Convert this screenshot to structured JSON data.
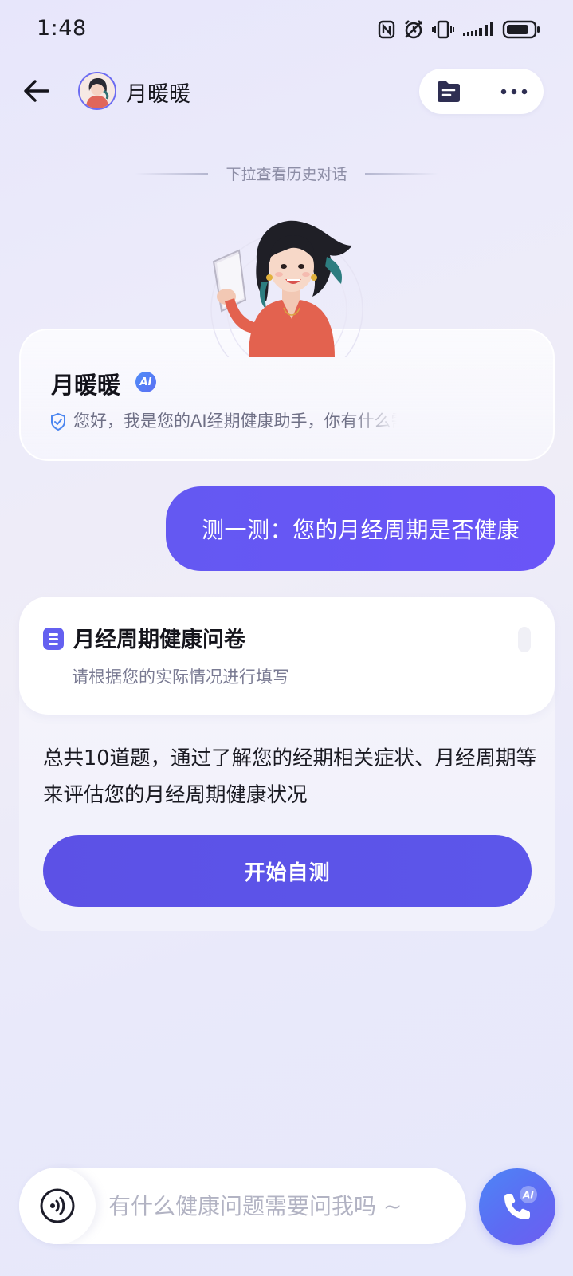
{
  "status_bar": {
    "time": "1:48",
    "icons": [
      "nfc-icon",
      "alarm-icon",
      "vibrate-icon",
      "signal-icon",
      "battery-icon"
    ]
  },
  "header": {
    "title": "月暖暖",
    "back_icon": "back-arrow-icon",
    "actions": [
      "notes-icon",
      "more-icon"
    ]
  },
  "history_hint": "下拉查看历史对话",
  "bot_card": {
    "name": "月暖暖",
    "badge": "AI",
    "intro": "您好，我是您的AI经期健康助手，你有什么需要帮助的吗"
  },
  "user_message": "测一测：您的月经周期是否健康",
  "survey": {
    "title": "月经周期健康问卷",
    "subtitle": "请根据您的实际情况进行填写",
    "description": "总共10道题，通过了解您的经期相关症状、月经周期等来评估您的月经周期健康状况",
    "button_label": "开始自测"
  },
  "input": {
    "placeholder": "有什么健康问题需要问我吗 ~",
    "value": ""
  },
  "call_button": {
    "badge": "AI"
  },
  "colors": {
    "accent": "#5c51e6",
    "user_bubble": "#6458f2",
    "call_button": "#5d6bf3"
  }
}
